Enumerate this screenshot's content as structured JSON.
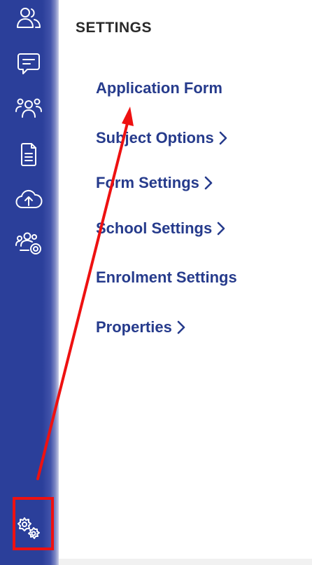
{
  "sidebar": {
    "items": [
      {
        "icon": "users-icon"
      },
      {
        "icon": "message-icon"
      },
      {
        "icon": "group-icon"
      },
      {
        "icon": "document-icon"
      },
      {
        "icon": "cloud-upload-icon"
      },
      {
        "icon": "users-settings-icon"
      },
      {
        "icon": "gears-icon"
      }
    ]
  },
  "settings": {
    "title": "SETTINGS",
    "menu": [
      {
        "label": "Application Form",
        "has_chevron": false
      },
      {
        "label": "Subject Options",
        "has_chevron": true
      },
      {
        "label": "Form Settings",
        "has_chevron": true
      },
      {
        "label": "School Settings",
        "has_chevron": true
      },
      {
        "label": "Enrolment Settings",
        "has_chevron": false
      },
      {
        "label": "Properties",
        "has_chevron": true
      }
    ]
  },
  "colors": {
    "sidebar": "#2b3f9a",
    "menu_text": "#263b8c",
    "title_text": "#2a2a2a",
    "annotation": "#ee1111"
  }
}
